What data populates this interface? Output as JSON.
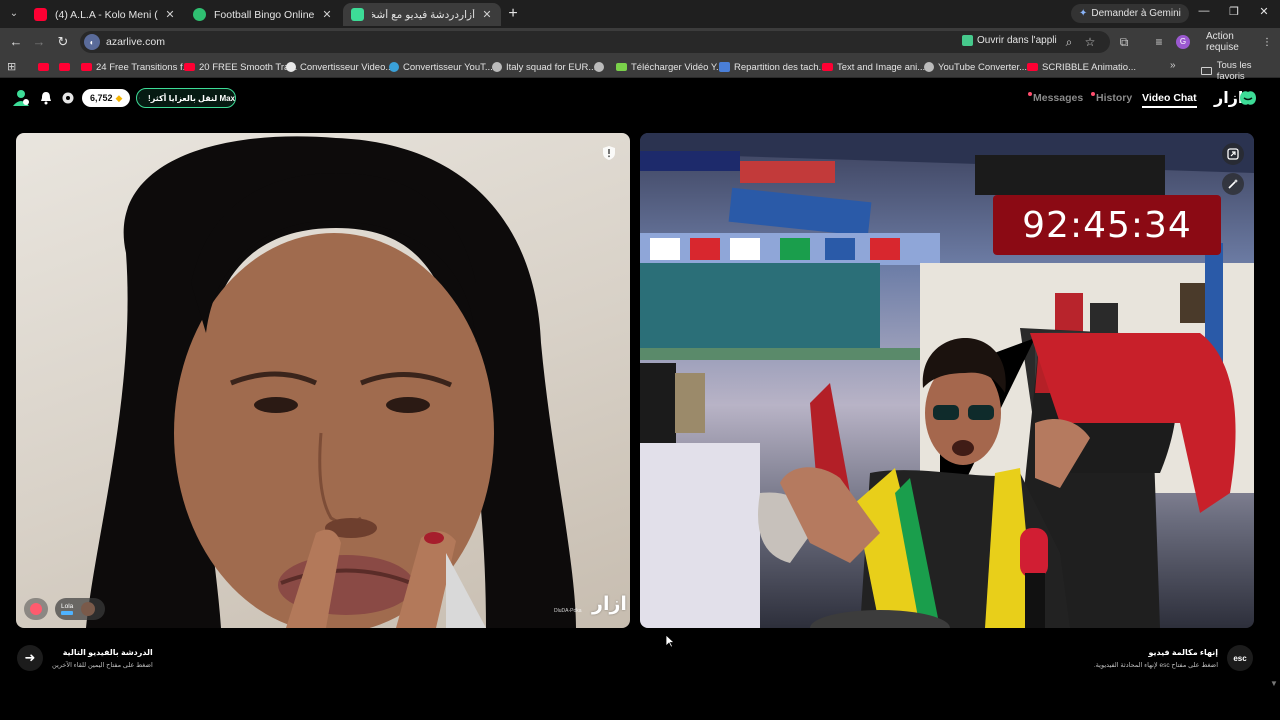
{
  "browser": {
    "tabs": [
      {
        "title": "(4) A.L.A - Kolo Meni (Official M",
        "favicon_color": "#ff0033",
        "active": false
      },
      {
        "title": "Football Bingo Online - Play No",
        "favicon_color": "#2fbf71",
        "active": false
      },
      {
        "title": "أزاردردشة فيديو مع أشخاص",
        "favicon_color": "#3ddc97",
        "active": true
      }
    ],
    "new_tab": "+",
    "gemini_label": "Demander à Gemini",
    "url": "azarlive.com",
    "open_app_label": "Ouvrir dans l'appli",
    "profile_initial": "G",
    "action_required_label": "Action requise",
    "bookmarks": [
      {
        "label": "",
        "icon": "youtube-icon"
      },
      {
        "label": "",
        "icon": "youtube-icon"
      },
      {
        "label": "24 Free Transitions f...",
        "icon": "youtube-icon"
      },
      {
        "label": "20 FREE Smooth Tra...",
        "icon": "youtube-icon"
      },
      {
        "label": "Convertisseur Video...",
        "icon": "google-icon"
      },
      {
        "label": "Convertisseur YouT...",
        "icon": "converter-icon"
      },
      {
        "label": "Italy squad for EUR...",
        "icon": "globe-icon"
      },
      {
        "label": "",
        "icon": "globe-icon"
      },
      {
        "label": "Télécharger Vidéo Y...",
        "icon": "download-icon"
      },
      {
        "label": "Repartition des tach...",
        "icon": "doc-icon"
      },
      {
        "label": "Text and Image ani...",
        "icon": "youtube-icon"
      },
      {
        "label": "YouTube Converter...",
        "icon": "globe-icon"
      },
      {
        "label": "SCRIBBLE Animatio...",
        "icon": "youtube-icon"
      }
    ],
    "all_bookmarks_label": "Tous les favoris"
  },
  "app": {
    "gems": "6,752",
    "max_promo": "Max لنقل بالعزايا أكثر!",
    "nav": {
      "messages": "Messages",
      "history": "History",
      "video_chat": "Video Chat"
    },
    "brand": "ازار",
    "left_video": {
      "user_name": "Lola",
      "watermark": "ازار",
      "watermark_id": "DluDA-Pdka"
    },
    "right_video": {
      "timer": "92:45:34"
    },
    "next_chat": {
      "title": "الدردشة بالفيديو التالية",
      "subtitle": "اضغط على مفتاح اليمين للقاء الآخرين"
    },
    "end_call": {
      "title": "إنهاء مكالمة فيديو",
      "subtitle": "اضغط على مفتاح esc لإنهاء المحادثة الفيديوية.",
      "key": "esc"
    }
  },
  "colors": {
    "accent_green": "#3ddc97",
    "timer_red": "#8b0a14",
    "notification_dot": "#ff4d6d"
  }
}
